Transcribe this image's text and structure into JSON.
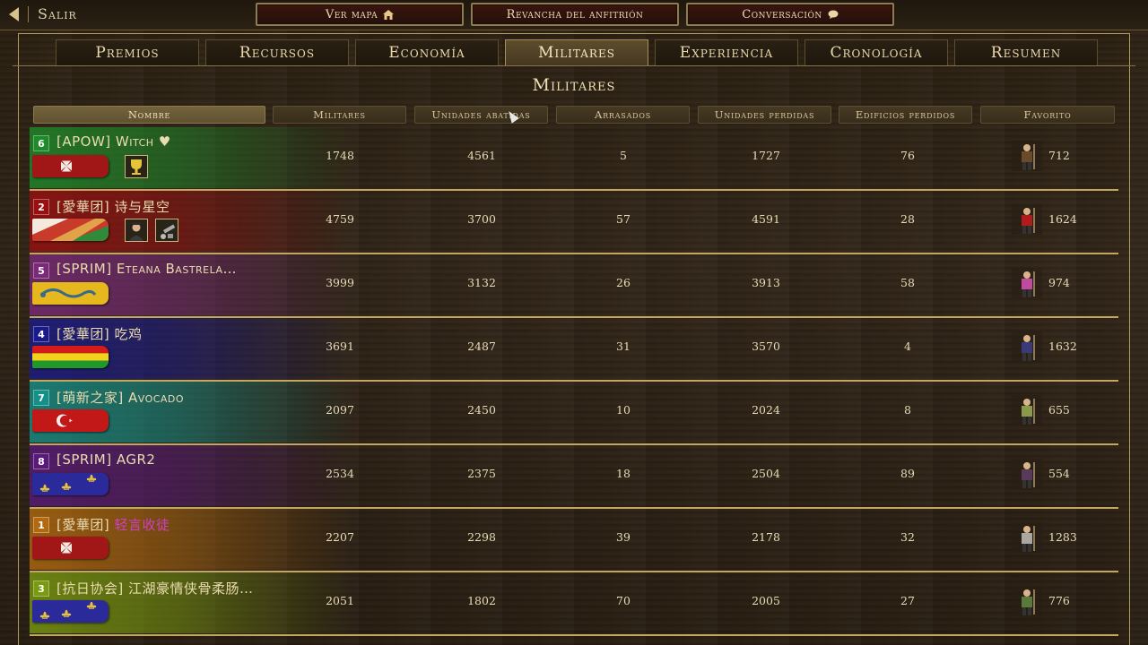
{
  "topbar": {
    "back_label": "Salir",
    "buttons": [
      {
        "label": "Ver mapa",
        "icon": "home-icon"
      },
      {
        "label": "Revancha del anfitrión",
        "icon": ""
      },
      {
        "label": "Conversación",
        "icon": "chat-icon"
      }
    ]
  },
  "tabs": [
    {
      "label": "Premios",
      "active": false
    },
    {
      "label": "Recursos",
      "active": false
    },
    {
      "label": "Economía",
      "active": false
    },
    {
      "label": "Militares",
      "active": true
    },
    {
      "label": "Experiencia",
      "active": false
    },
    {
      "label": "Cronología",
      "active": false
    },
    {
      "label": "Resumen",
      "active": false
    }
  ],
  "section_title": "Militares",
  "columns": [
    "Nombre",
    "Militares",
    "Unidades abatidas",
    "Arrasados",
    "Unidades perdidas",
    "Edificios perdidos",
    "Favorito"
  ],
  "colors": {
    "green": "#1f8a2a",
    "red": "#9a1010",
    "purple": "#7a2a78",
    "blue": "#1a1a8a",
    "teal": "#159088",
    "violet": "#5a1a7a",
    "orange": "#b26a10",
    "olive": "#7a9a10"
  },
  "players": [
    {
      "team": "6",
      "color": "#1f8a2a",
      "name": "[APOW] Witch ♥",
      "name_hl": "",
      "flag": "maltese-cross-red",
      "minis": [
        "trophy-icon"
      ],
      "militares": "1748",
      "abatidas": "4561",
      "arrasados": "5",
      "perdidas": "1727",
      "edificios": "76",
      "favorito": "712",
      "fav_icon": "musketeer-icon"
    },
    {
      "team": "2",
      "color": "#9a1010",
      "name": "[愛華团] 诗与星空",
      "name_hl": "",
      "flag": "red-green-stripes",
      "minis": [
        "hero-portrait-icon",
        "cannon-icon"
      ],
      "militares": "4759",
      "abatidas": "3700",
      "arrasados": "57",
      "perdidas": "4591",
      "edificios": "28",
      "favorito": "1624",
      "fav_icon": "redcoat-icon"
    },
    {
      "team": "5",
      "color": "#7a2a78",
      "name": "[SPRIM] Eteana Bastrela…",
      "name_hl": "",
      "flag": "yellow-dragon",
      "minis": [],
      "militares": "3999",
      "abatidas": "3132",
      "arrasados": "26",
      "perdidas": "3913",
      "edificios": "58",
      "favorito": "974",
      "fav_icon": "pink-soldier-icon"
    },
    {
      "team": "4",
      "color": "#1a1a8a",
      "name": "[愛華团] 吃鸡",
      "name_hl": "",
      "flag": "red-yellow-green-stripes",
      "minis": [],
      "militares": "3691",
      "abatidas": "2487",
      "arrasados": "31",
      "perdidas": "3570",
      "edificios": "4",
      "favorito": "1632",
      "fav_icon": "pikeman-icon"
    },
    {
      "team": "7",
      "color": "#159088",
      "name": "[萌新之家] Avocado",
      "name_hl": "",
      "flag": "crescent-star",
      "minis": [],
      "militares": "2097",
      "abatidas": "2450",
      "arrasados": "10",
      "perdidas": "2024",
      "edificios": "8",
      "favorito": "655",
      "fav_icon": "janissary-icon"
    },
    {
      "team": "8",
      "color": "#5a1a7a",
      "name": "[SPRIM] AGR2",
      "name_hl": "",
      "flag": "fleur-de-lis-blue",
      "minis": [],
      "militares": "2534",
      "abatidas": "2375",
      "arrasados": "18",
      "perdidas": "2504",
      "edificios": "89",
      "favorito": "554",
      "fav_icon": "crossbow-icon"
    },
    {
      "team": "1",
      "color": "#b26a10",
      "name": "[愛華团] ",
      "name_hl": "轻言收徒",
      "flag": "maltese-cross-red",
      "minis": [],
      "militares": "2207",
      "abatidas": "2298",
      "arrasados": "39",
      "perdidas": "2178",
      "edificios": "32",
      "favorito": "1283",
      "fav_icon": "knight-icon"
    },
    {
      "team": "3",
      "color": "#7a9a10",
      "name": "[抗日协会] 江湖豪情侠骨柔肠…",
      "name_hl": "",
      "flag": "fleur-de-lis-blue",
      "minis": [],
      "militares": "2051",
      "abatidas": "1802",
      "arrasados": "70",
      "perdidas": "2005",
      "edificios": "27",
      "favorito": "776",
      "fav_icon": "rifleman-icon"
    }
  ]
}
